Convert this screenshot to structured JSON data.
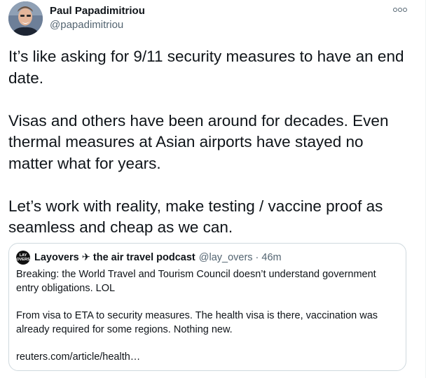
{
  "tweet": {
    "author": {
      "name": "Paul Papadimitriou",
      "handle": "@papadimitriou"
    },
    "paragraphs": [
      "It’s like asking for 9/11 security measures to have an end date.",
      "Visas and others have been around for decades. Even thermal measures at Asian airports have stayed no matter what for years.",
      "Let’s work with reality, make testing / vaccine proof as seamless and cheap as we can."
    ],
    "more_icon": "more-options-icon"
  },
  "quoted_tweet": {
    "logo_text_top": "LAY",
    "logo_text_bottom": "OVERS",
    "author_name": "Layovers ✈ the air travel podcast",
    "meta": "@lay_overs · 46m",
    "paragraphs": [
      "Breaking: the World Travel and Tourism Council doesn’t understand government entry obligations. LOL",
      "From visa to ETA to security measures. The health visa is there, vaccination was already required for some regions. Nothing new."
    ],
    "link": "reuters.com/article/health…"
  }
}
